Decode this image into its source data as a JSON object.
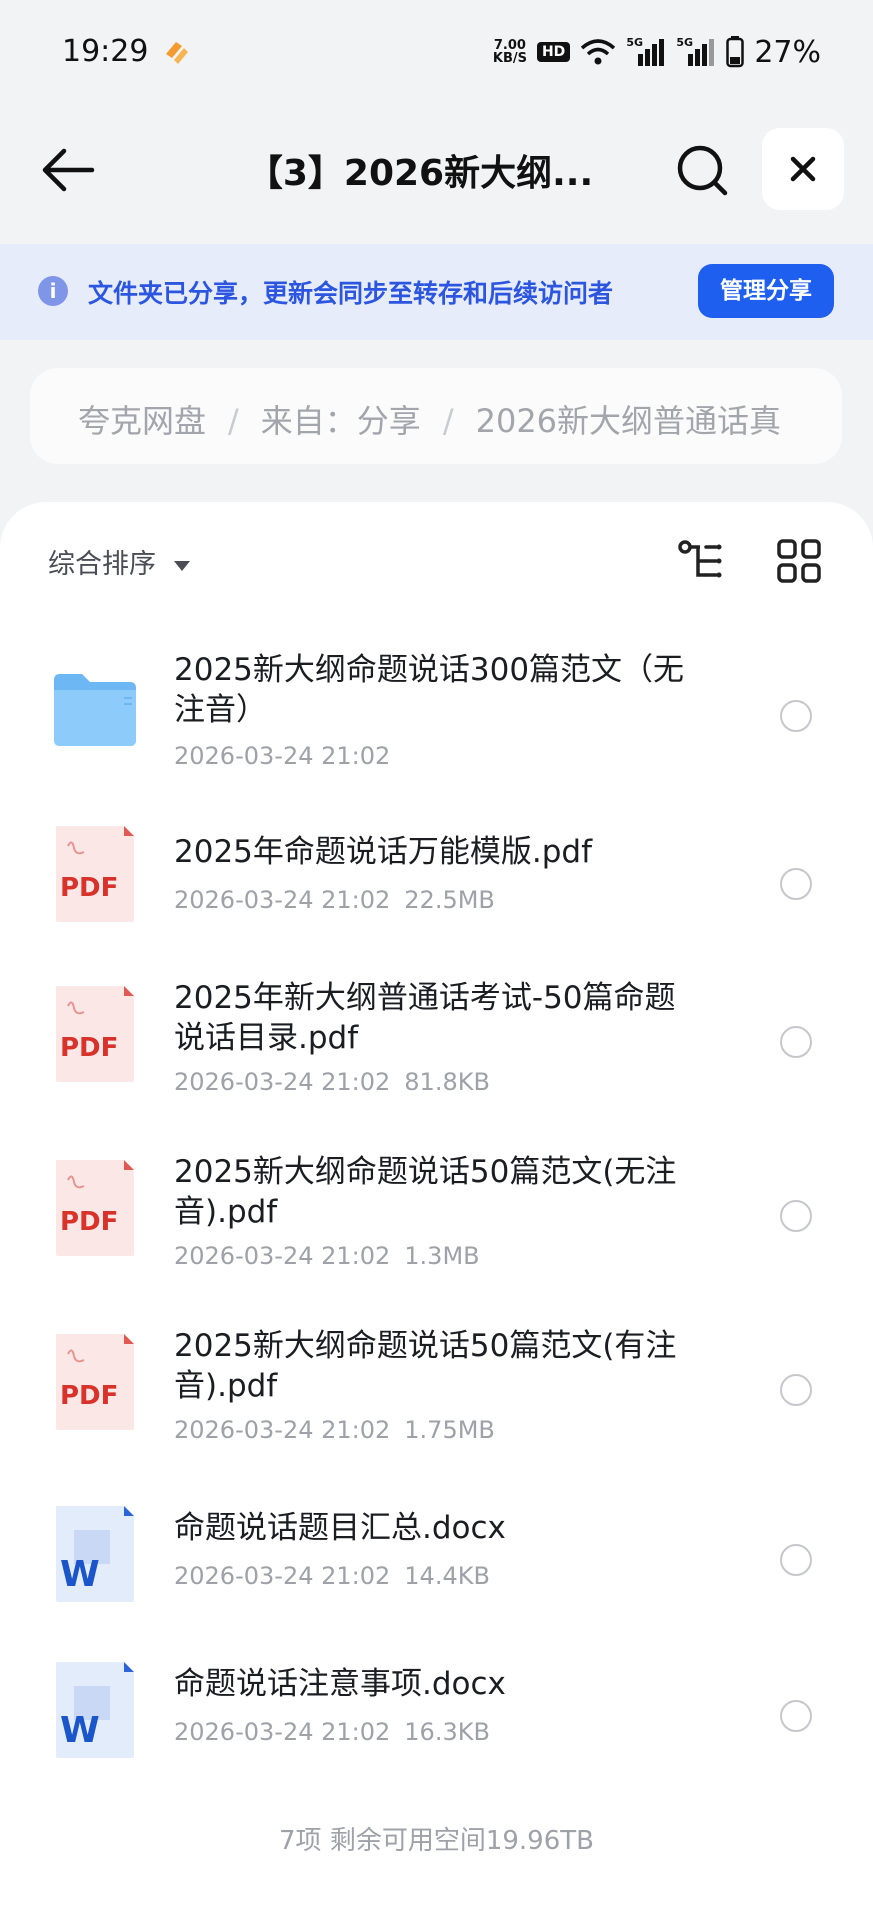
{
  "status_bar": {
    "time": "19:29",
    "net_speed_value": "7.00",
    "net_speed_unit": "KB/S",
    "hd": "HD",
    "signal1_label": "5G",
    "signal2_label": "5G",
    "battery": "27%"
  },
  "header": {
    "title": "【3】2026新大纲..."
  },
  "notice": {
    "info_glyph": "i",
    "text": "文件夹已分享，更新会同步至转存和后续访问者",
    "manage_label": "管理分享"
  },
  "breadcrumb": [
    "夸克网盘",
    "来自：分享",
    "2026新大纲普通话真"
  ],
  "breadcrumb_separator": "/",
  "toolbar": {
    "sort_label": "综合排序"
  },
  "files": [
    {
      "type": "folder",
      "name_line1": "2025新大纲命题说话300篇范文（无",
      "name_line2": "注音）",
      "date": "2026-03-24 21:02",
      "size": ""
    },
    {
      "type": "pdf",
      "name_line1": "2025年命题说话万能模版.pdf",
      "name_line2": "",
      "date": "2026-03-24 21:02",
      "size": "22.5MB"
    },
    {
      "type": "pdf",
      "name_line1": "2025年新大纲普通话考试-50篇命题",
      "name_line2": "说话目录.pdf",
      "date": "2026-03-24 21:02",
      "size": "81.8KB"
    },
    {
      "type": "pdf",
      "name_line1": "2025新大纲命题说话50篇范文(无注",
      "name_line2": "音).pdf",
      "date": "2026-03-24 21:02",
      "size": "1.3MB"
    },
    {
      "type": "pdf",
      "name_line1": "2025新大纲命题说话50篇范文(有注",
      "name_line2": "音).pdf",
      "date": "2026-03-24 21:02",
      "size": "1.75MB"
    },
    {
      "type": "docx",
      "name_line1": "命题说话题目汇总.docx",
      "name_line2": "",
      "date": "2026-03-24 21:02",
      "size": "14.4KB"
    },
    {
      "type": "docx",
      "name_line1": "命题说话注意事项.docx",
      "name_line2": "",
      "date": "2026-03-24 21:02",
      "size": "16.3KB"
    }
  ],
  "icon_labels": {
    "pdf": "PDF",
    "docx": "W"
  },
  "footer": "7项 剩余可用空间19.96TB",
  "colors": {
    "accent": "#1f5ff0",
    "notice_bg": "#e7ecfb",
    "pdf_red": "#d8322b",
    "word_blue": "#1a56c9",
    "folder_blue": "#5fb0f4"
  }
}
